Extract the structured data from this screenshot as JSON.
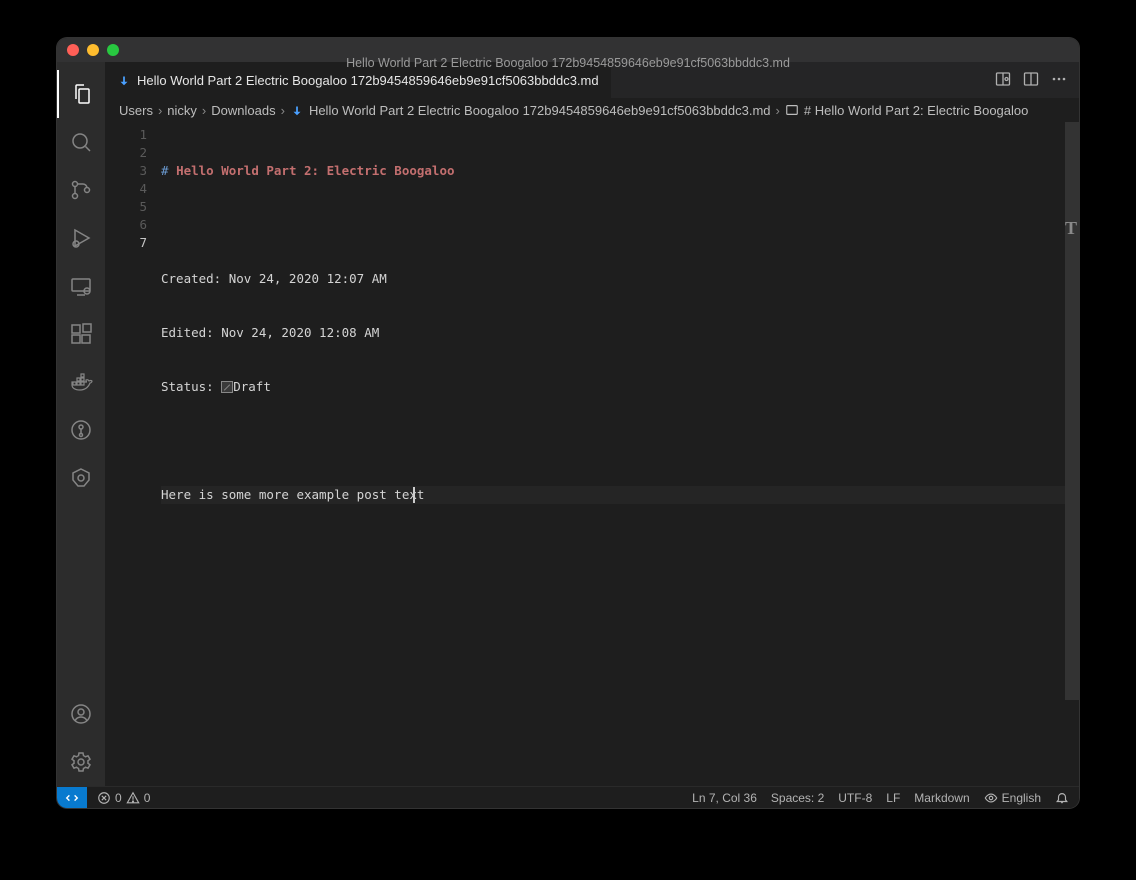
{
  "title": "Hello World Part 2 Electric Boogaloo 172b9454859646eb9e91cf5063bbddc3.md",
  "tab": {
    "label": "Hello World Part 2 Electric Boogaloo 172b9454859646eb9e91cf5063bbddc3.md"
  },
  "breadcrumb": {
    "items": [
      "Users",
      "nicky",
      "Downloads",
      "Hello World Part 2 Electric Boogaloo 172b9454859646eb9e91cf5063bbddc3.md"
    ],
    "symbol": "# Hello World Part 2: Electric Boogaloo"
  },
  "editor": {
    "line_numbers": [
      "1",
      "2",
      "3",
      "4",
      "5",
      "6",
      "7"
    ],
    "heading_hash": "#",
    "heading_text": "Hello World Part 2: Electric Boogaloo",
    "created": "Created: Nov 24, 2020 12:07 AM",
    "edited": "Edited: Nov 24, 2020 12:08 AM",
    "status_label": "Status: ",
    "status_value": "Draft",
    "body_prefix": "Here is some more example post ",
    "body_last": "text",
    "cursor": {
      "line": 7,
      "col": 36
    }
  },
  "status": {
    "errors": "0",
    "warnings": "0",
    "position": "Ln 7, Col 36",
    "indent": "Spaces: 2",
    "encoding": "UTF-8",
    "eol": "LF",
    "language": "Markdown",
    "spell": "English"
  }
}
